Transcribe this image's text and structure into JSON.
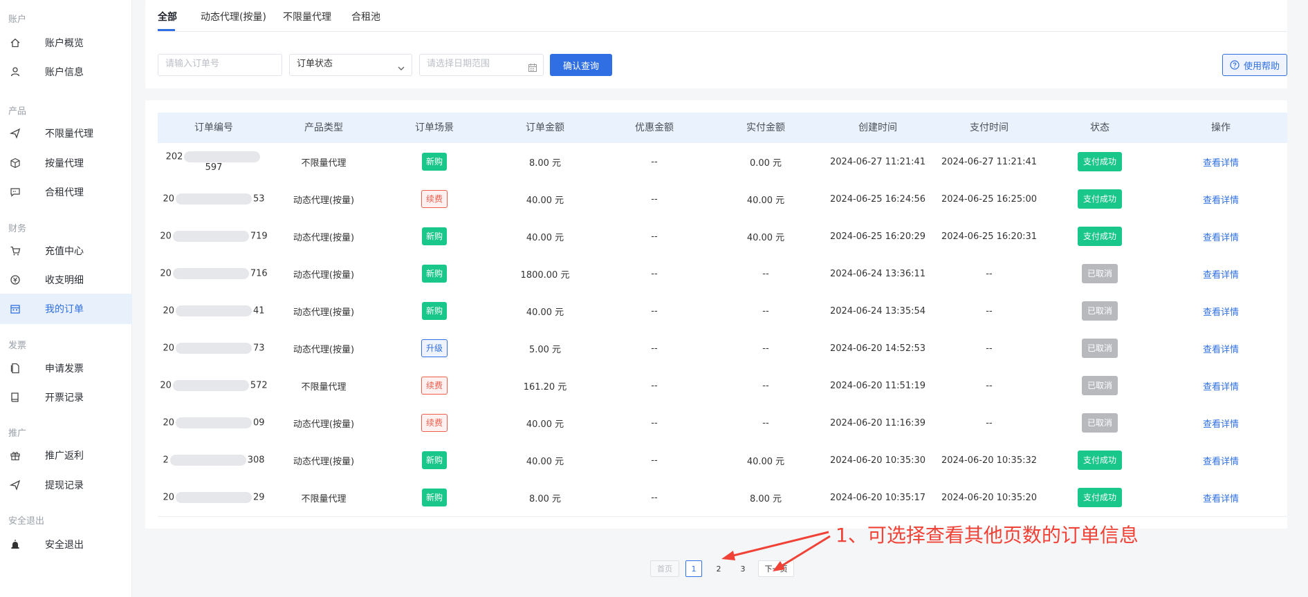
{
  "sidebar": {
    "sections": [
      {
        "title": "账户",
        "items": [
          {
            "label": "账户概览",
            "icon": "home-icon"
          },
          {
            "label": "账户信息",
            "icon": "user-icon"
          }
        ]
      },
      {
        "title": "产品",
        "items": [
          {
            "label": "不限量代理",
            "icon": "send-icon"
          },
          {
            "label": "按量代理",
            "icon": "cube-icon"
          },
          {
            "label": "合租代理",
            "icon": "chat-icon"
          }
        ]
      },
      {
        "title": "财务",
        "items": [
          {
            "label": "充值中心",
            "icon": "cart-icon"
          },
          {
            "label": "收支明细",
            "icon": "coin-icon"
          },
          {
            "label": "我的订单",
            "icon": "calendar-icon",
            "active": true
          }
        ]
      },
      {
        "title": "发票",
        "items": [
          {
            "label": "申请发票",
            "icon": "document-icon"
          },
          {
            "label": "开票记录",
            "icon": "book-icon"
          }
        ]
      },
      {
        "title": "推广",
        "items": [
          {
            "label": "推广返利",
            "icon": "gift-icon"
          },
          {
            "label": "提现记录",
            "icon": "send-icon"
          }
        ]
      },
      {
        "title": "安全退出",
        "items": [
          {
            "label": "安全退出",
            "icon": "alarm-icon"
          }
        ]
      }
    ]
  },
  "tabs": [
    {
      "label": "全部",
      "active": true
    },
    {
      "label": "动态代理(按量)"
    },
    {
      "label": "不限量代理"
    },
    {
      "label": "合租池"
    }
  ],
  "filters": {
    "order_no_placeholder": "请输入订单号",
    "status_value": "订单状态",
    "date_placeholder": "请选择日期范围",
    "confirm_label": "确认查询",
    "help_label": "使用帮助"
  },
  "table": {
    "columns": [
      "订单编号",
      "产品类型",
      "订单场景",
      "订单金额",
      "优惠金额",
      "实付金额",
      "创建时间",
      "支付时间",
      "状态",
      "操作"
    ],
    "rows": [
      {
        "prefix": "202",
        "suffix": "597",
        "product": "不限量代理",
        "scene": "新购",
        "scene_type": "new",
        "amount": "8.00 元",
        "discount": "--",
        "paid": "0.00 元",
        "created": "2024-06-27 11:21:41",
        "pay_time": "2024-06-27 11:21:41",
        "status": "支付成功",
        "status_type": "ok",
        "action": "查看详情"
      },
      {
        "prefix": "20",
        "suffix": "53",
        "product": "动态代理(按量)",
        "scene": "续费",
        "scene_type": "renew",
        "amount": "40.00 元",
        "discount": "--",
        "paid": "40.00 元",
        "created": "2024-06-25 16:24:56",
        "pay_time": "2024-06-25 16:25:00",
        "status": "支付成功",
        "status_type": "ok",
        "action": "查看详情"
      },
      {
        "prefix": "20",
        "suffix": "719",
        "product": "动态代理(按量)",
        "scene": "新购",
        "scene_type": "new",
        "amount": "40.00 元",
        "discount": "--",
        "paid": "40.00 元",
        "created": "2024-06-25 16:20:29",
        "pay_time": "2024-06-25 16:20:31",
        "status": "支付成功",
        "status_type": "ok",
        "action": "查看详情"
      },
      {
        "prefix": "20",
        "suffix": "716",
        "product": "动态代理(按量)",
        "scene": "新购",
        "scene_type": "new",
        "amount": "1800.00 元",
        "discount": "--",
        "paid": "--",
        "created": "2024-06-24 13:36:11",
        "pay_time": "--",
        "status": "已取消",
        "status_type": "cancel",
        "action": "查看详情"
      },
      {
        "prefix": "20",
        "suffix": "41",
        "product": "动态代理(按量)",
        "scene": "新购",
        "scene_type": "new",
        "amount": "40.00 元",
        "discount": "--",
        "paid": "--",
        "created": "2024-06-24 13:35:54",
        "pay_time": "--",
        "status": "已取消",
        "status_type": "cancel",
        "action": "查看详情"
      },
      {
        "prefix": "20",
        "suffix": "73",
        "product": "动态代理(按量)",
        "scene": "升级",
        "scene_type": "up",
        "amount": "5.00 元",
        "discount": "--",
        "paid": "--",
        "created": "2024-06-20 14:52:53",
        "pay_time": "--",
        "status": "已取消",
        "status_type": "cancel",
        "action": "查看详情"
      },
      {
        "prefix": "20",
        "suffix": "572",
        "product": "不限量代理",
        "scene": "续费",
        "scene_type": "renew",
        "amount": "161.20 元",
        "discount": "--",
        "paid": "--",
        "created": "2024-06-20 11:51:19",
        "pay_time": "--",
        "status": "已取消",
        "status_type": "cancel",
        "action": "查看详情"
      },
      {
        "prefix": "20",
        "suffix": "09",
        "product": "动态代理(按量)",
        "scene": "续费",
        "scene_type": "renew",
        "amount": "40.00 元",
        "discount": "--",
        "paid": "--",
        "created": "2024-06-20 11:16:39",
        "pay_time": "--",
        "status": "已取消",
        "status_type": "cancel",
        "action": "查看详情"
      },
      {
        "prefix": "2",
        "suffix": "308",
        "product": "动态代理(按量)",
        "scene": "新购",
        "scene_type": "new",
        "amount": "40.00 元",
        "discount": "--",
        "paid": "40.00 元",
        "created": "2024-06-20 10:35:30",
        "pay_time": "2024-06-20 10:35:32",
        "status": "支付成功",
        "status_type": "ok",
        "action": "查看详情"
      },
      {
        "prefix": "20",
        "suffix": "29",
        "product": "不限量代理",
        "scene": "新购",
        "scene_type": "new",
        "amount": "8.00 元",
        "discount": "--",
        "paid": "8.00 元",
        "created": "2024-06-20 10:35:17",
        "pay_time": "2024-06-20 10:35:20",
        "status": "支付成功",
        "status_type": "ok",
        "action": "查看详情"
      }
    ]
  },
  "pagination": {
    "first": "首页",
    "pages": [
      "1",
      "2",
      "3"
    ],
    "current": "1",
    "next": "下一页"
  },
  "annotation": "1、可选择查看其他页数的订单信息",
  "colors": {
    "accent": "#2f6fe3",
    "success": "#19c78b",
    "danger": "#ef5b4c",
    "muted": "#b7b9bd",
    "annotation": "#f04236"
  }
}
